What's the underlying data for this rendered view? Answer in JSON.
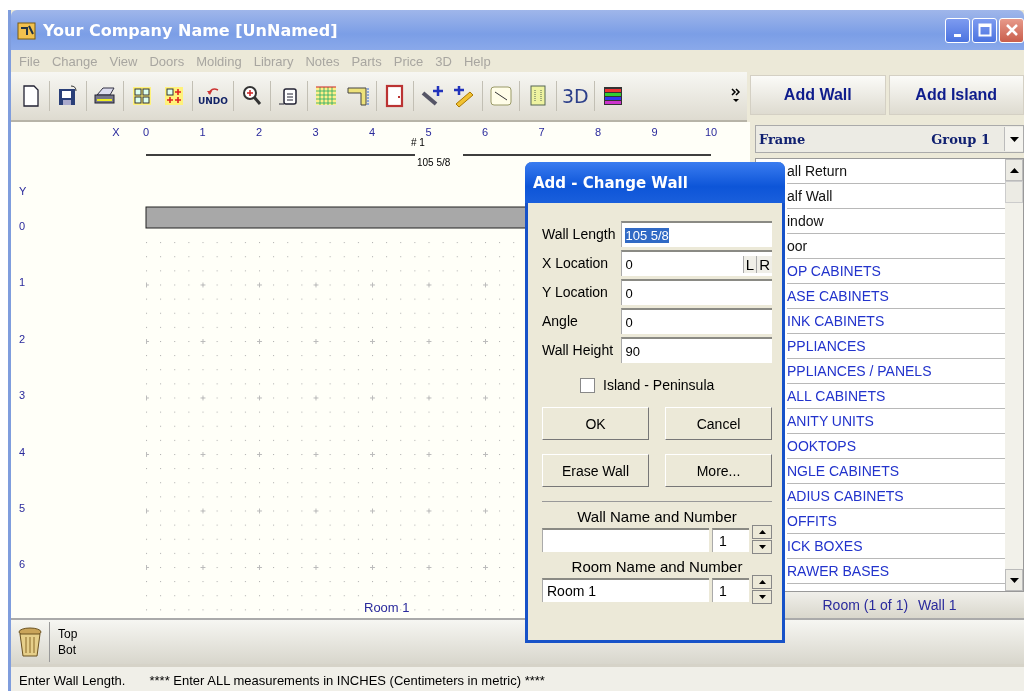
{
  "window": {
    "title": "Your Company Name [UnNamed]"
  },
  "menu": [
    {
      "label": "File",
      "disabled": true
    },
    {
      "label": "Change",
      "disabled": true
    },
    {
      "label": "View",
      "disabled": true
    },
    {
      "label": "Doors",
      "disabled": true
    },
    {
      "label": "Molding",
      "disabled": true
    },
    {
      "label": "Library",
      "disabled": true
    },
    {
      "label": "Notes",
      "disabled": true
    },
    {
      "label": "Parts",
      "disabled": true
    },
    {
      "label": "Price",
      "disabled": true
    },
    {
      "label": "3D",
      "disabled": true
    },
    {
      "label": "Help",
      "disabled": true
    }
  ],
  "toolbar": {
    "undo_label": "UNDO",
    "view3d_label": "3D"
  },
  "canvas": {
    "x_axis_label": "X",
    "x_ticks": [
      "0",
      "1",
      "2",
      "3",
      "4",
      "5",
      "6",
      "7",
      "8",
      "9",
      "10"
    ],
    "y_axis_label": "Y",
    "y_ticks": [
      "0",
      "1",
      "2",
      "3",
      "4",
      "5",
      "6"
    ],
    "wall": {
      "number": "# 1",
      "length": "105 5/8"
    },
    "room_label": "Room 1"
  },
  "right_panel": {
    "buttons": [
      "Add Wall",
      "Add Island"
    ],
    "dropdown": {
      "label": "Frame",
      "value": "Group 1"
    },
    "items": [
      {
        "text": "all Return",
        "kind": "item"
      },
      {
        "text": "alf Wall",
        "kind": "item"
      },
      {
        "text": "indow",
        "kind": "item"
      },
      {
        "text": "oor",
        "kind": "item"
      },
      {
        "text": "OP CABINETS",
        "kind": "category"
      },
      {
        "text": "ASE CABINETS",
        "kind": "category"
      },
      {
        "text": "INK CABINETS",
        "kind": "category"
      },
      {
        "text": "PPLIANCES",
        "kind": "category"
      },
      {
        "text": "PPLIANCES / PANELS",
        "kind": "category"
      },
      {
        "text": "ALL CABINETS",
        "kind": "category"
      },
      {
        "text": "ANITY UNITS",
        "kind": "category"
      },
      {
        "text": "OOKTOPS",
        "kind": "category"
      },
      {
        "text": "NGLE CABINETS",
        "kind": "category"
      },
      {
        "text": "ADIUS CABINETS",
        "kind": "category"
      },
      {
        "text": "OFFITS",
        "kind": "category"
      },
      {
        "text": "ICK BOXES",
        "kind": "category"
      },
      {
        "text": "RAWER BASES",
        "kind": "category"
      }
    ],
    "footer": {
      "room": "Room (1 of 1)",
      "wall": "Wall 1"
    }
  },
  "dialog": {
    "title": "Add - Change Wall",
    "fields": [
      {
        "label": "Wall Length",
        "value": "105 5/8",
        "highlighted": true
      },
      {
        "label": "X Location",
        "value": "0",
        "highlighted": false,
        "side_buttons": [
          "L",
          "R"
        ]
      },
      {
        "label": "Y Location",
        "value": "0",
        "highlighted": false
      },
      {
        "label": "Angle",
        "value": "0",
        "highlighted": false
      },
      {
        "label": "Wall Height",
        "value": "90",
        "highlighted": false
      }
    ],
    "checkbox": {
      "label": "Island - Peninsula",
      "checked": false
    },
    "buttons": [
      "OK",
      "Cancel",
      "Erase Wall",
      "More..."
    ],
    "wall_name": {
      "label": "Wall Name and Number",
      "number": "1"
    },
    "room_name": {
      "label": "Room Name and Number",
      "value": "Room 1",
      "number": "1"
    }
  },
  "bottom_bar": {
    "views": [
      "Top",
      "Bot"
    ]
  },
  "status_bar": [
    "Enter Wall Length.",
    "**** Enter ALL measurements in INCHES (Centimeters in metric) ****"
  ]
}
